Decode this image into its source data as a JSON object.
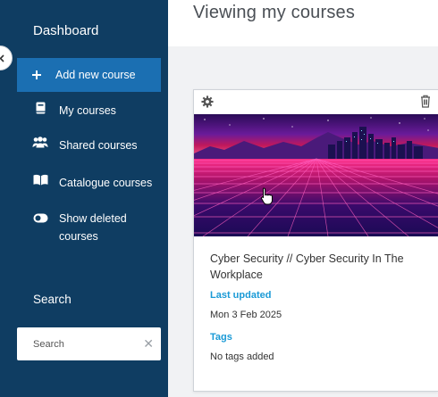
{
  "sidebar": {
    "title": "Dashboard",
    "items": [
      {
        "label": "Add new course",
        "icon": "plus-icon",
        "active": true
      },
      {
        "label": "My courses",
        "icon": "book-icon"
      },
      {
        "label": "Shared courses",
        "icon": "users-icon"
      },
      {
        "label": "Catalogue courses",
        "icon": "open-book-icon"
      },
      {
        "label": "Show deleted courses",
        "icon": "toggle-icon"
      }
    ],
    "search_label": "Search",
    "search_placeholder": "Search"
  },
  "header": {
    "title": "Viewing my courses"
  },
  "course_card": {
    "title": "Cyber Security // Cyber Security In The Workplace",
    "last_updated_label": "Last updated",
    "last_updated_value": "Mon 3 Feb 2025",
    "tags_label": "Tags",
    "tags_value": "No tags added"
  },
  "colors": {
    "sidebar_bg": "#0f3d62",
    "active_item": "#1b6fb2",
    "accent": "#1a9ad6"
  }
}
